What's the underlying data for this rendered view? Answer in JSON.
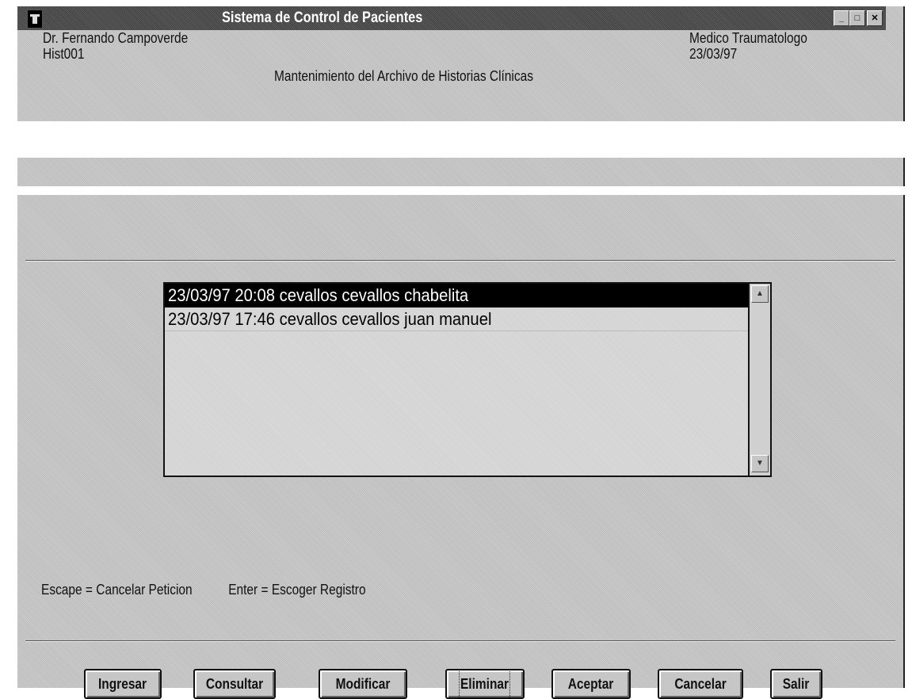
{
  "top_window": {
    "title": "Sistema de Control de Pacientes",
    "doctor": "Dr. Fernando Campoverde",
    "code": "Hist001",
    "specialty": "Medico Traumatologo",
    "date": "23/03/97",
    "subtitle": "Mantenimiento del Archivo de Historias Clínicas",
    "buttons": {
      "minimize": "_",
      "maximize": "□",
      "close": "✕"
    }
  },
  "list": {
    "rows": [
      {
        "text": "23/03/97  20:08  cevallos cevallos  chabelita",
        "selected": true
      },
      {
        "text": "23/03/97  17:46  cevallos cevallos  juan manuel",
        "selected": false
      }
    ],
    "scroll_up": "▲",
    "scroll_down": "▼"
  },
  "help": {
    "escape": "Escape = Cancelar Peticion",
    "enter": "Enter = Escoger Registro"
  },
  "buttons": {
    "ingresar": "Ingresar",
    "consultar": "Consultar",
    "modificar": "Modificar",
    "eliminar": "Eliminar",
    "aceptar": "Aceptar",
    "cancelar": "Cancelar",
    "salir": "Salir"
  }
}
